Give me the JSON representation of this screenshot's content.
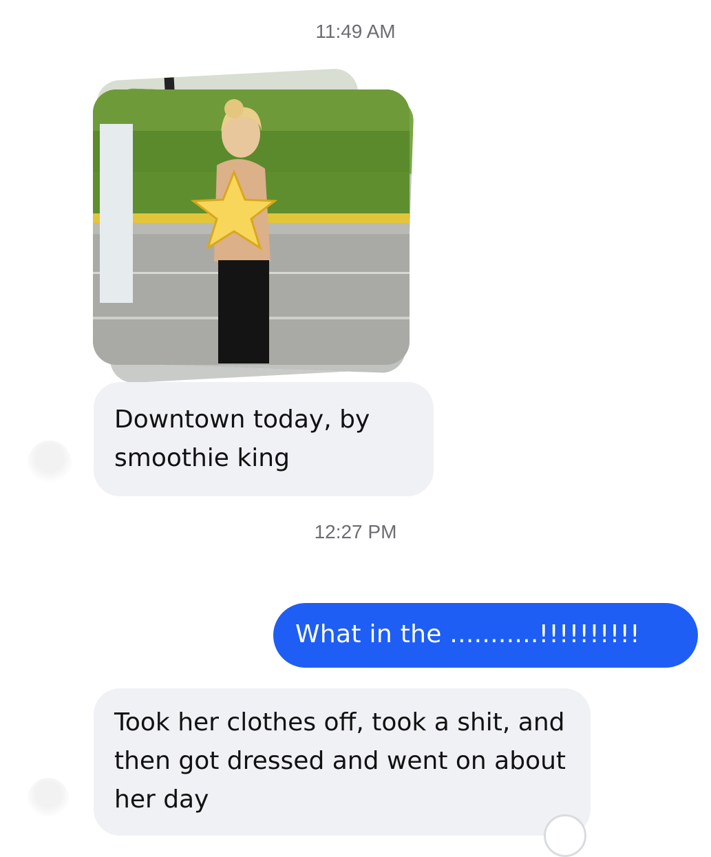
{
  "chat": {
    "timestamp_1": "11:49 AM",
    "timestamp_2": "12:27 PM",
    "messages": [
      {
        "sender": "other",
        "text": "Downtown today, by smoothie king"
      },
      {
        "sender": "me",
        "text": "What in the ...........!!!!!!!!!!"
      },
      {
        "sender": "other",
        "text": "Took her clothes off, took a shit, and then got dressed and went on about her day"
      }
    ]
  },
  "photo_message": {
    "type": "photo-stack",
    "count_visible_layers": 3
  },
  "colors": {
    "outgoing_bubble": "#1e5ef4",
    "incoming_bubble": "#f0f1f5",
    "timestamp_text": "#6b6d72"
  },
  "icons": {
    "censor": "star-emoji-icon"
  }
}
